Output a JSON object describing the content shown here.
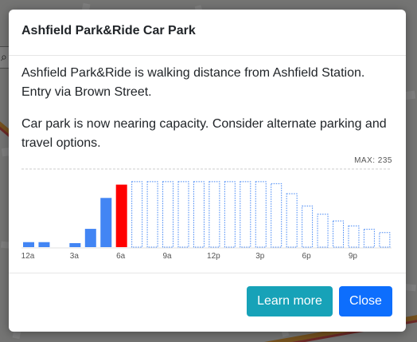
{
  "modal": {
    "title": "Ashfield Park&Ride Car Park",
    "paragraph1": "Ashfield Park&Ride is walking distance from Ashfield Station. Entry via Brown Street.",
    "paragraph2": "Car park is now nearing capacity. Consider alternate parking and travel options.",
    "learn_more_label": "Learn more",
    "close_label": "Close"
  },
  "map": {
    "search_icon": "search-icon"
  },
  "colors": {
    "past": "#4285f4",
    "current": "#ff0000",
    "forecast_stroke": "#4285f4",
    "learn_more": "#17a2b8",
    "close": "#0d6efd"
  },
  "chart_data": {
    "type": "bar",
    "max_label": "MAX: 235",
    "ylim": [
      0,
      235
    ],
    "grid": false,
    "x_tick_labels": [
      "12a",
      "3a",
      "6a",
      "9a",
      "12p",
      "3p",
      "6p",
      "9p"
    ],
    "x_tick_hours": [
      0,
      3,
      6,
      9,
      12,
      15,
      18,
      21
    ],
    "hours": [
      0,
      1,
      2,
      3,
      4,
      5,
      6,
      7,
      8,
      9,
      10,
      11,
      12,
      13,
      14,
      15,
      16,
      17,
      18,
      19,
      20,
      21,
      22,
      23
    ],
    "series": [
      {
        "status": "past",
        "hours": [
          0,
          1,
          2,
          3,
          4,
          5
        ],
        "values": [
          15,
          15,
          0,
          12,
          55,
          148
        ]
      },
      {
        "status": "current",
        "hours": [
          6
        ],
        "values": [
          188
        ]
      },
      {
        "status": "forecast",
        "hours": [
          7,
          8,
          9,
          10,
          11,
          12,
          13,
          14,
          15,
          16,
          17,
          18,
          19,
          20,
          21,
          22,
          23
        ],
        "values": [
          198,
          198,
          198,
          198,
          198,
          198,
          198,
          198,
          198,
          192,
          162,
          125,
          100,
          80,
          65,
          55,
          45
        ]
      }
    ]
  }
}
